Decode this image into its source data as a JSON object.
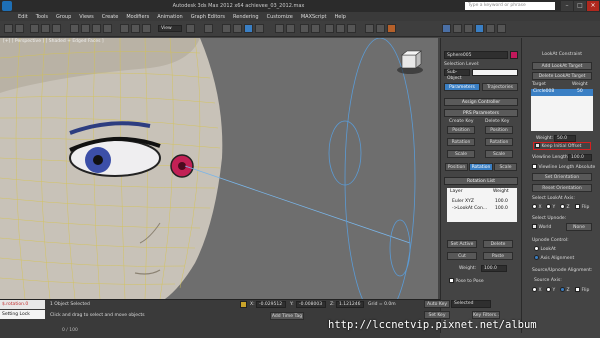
{
  "window": {
    "title": "Autodesk 3ds Max 2012 x64      achievee_03_2012.max",
    "search_placeholder": "Type a keyword or phrase"
  },
  "menu": [
    "Edit",
    "Tools",
    "Group",
    "Views",
    "Create",
    "Modifiers",
    "Animation",
    "Graph Editors",
    "Rendering",
    "Customize",
    "MAXScript",
    "Help"
  ],
  "toolbar": {
    "view_dropdown": "View"
  },
  "viewport": {
    "label": "[+] [ Perspective ] [ Shaded + Edged Faces ]"
  },
  "command_panel": {
    "object_name": "Sphere005",
    "selection_level_label": "Selection Level:",
    "selection_level_value": "Sub-Object",
    "tabs": [
      "Parameters",
      "Trajectories"
    ],
    "assign_controller": "Assign Controller",
    "prs_params": "PRS Parameters",
    "create_key": "Create Key",
    "delete_key": "Delete Key",
    "left_keys": [
      "Position",
      "Rotation",
      "Scale"
    ],
    "right_keys": [
      "Position",
      "Rotation",
      "Scale"
    ],
    "mode_buttons": [
      "Position",
      "Rotation",
      "Scale"
    ],
    "rotation_list": "Rotation List",
    "list_headers": {
      "layer": "Layer",
      "weight": "Weight"
    },
    "list_rows": [
      {
        "layer": "Euler XYZ",
        "weight": "100.0"
      },
      {
        "layer": "->LookAt Con...",
        "weight": "100.0"
      }
    ],
    "set_active": "Set Active",
    "delete": "Delete",
    "cut": "Cut",
    "paste": "Paste",
    "weight_label": "Weight:",
    "weight_value": "100.0",
    "pose_to_pose": "Pose to Pose"
  },
  "lookat_panel": {
    "title": "LookAt Constraint",
    "add_target": "Add LookAt Target",
    "delete_target": "Delete LookAt Target",
    "target_header": "Target",
    "weight_header": "Weight",
    "target_row": {
      "name": "Circle008",
      "weight": "50"
    },
    "weight_label": "Weight:",
    "weight_value": "50.0",
    "keep_initial_offset": "Keep Initial Offset",
    "viewline_length_label": "Viewline Length:",
    "viewline_length_value": "100.0",
    "viewline_absolute": "Viewline Length Absolute",
    "set_orientation": "Set Orientation",
    "reset_orientation": "Reset Orientation",
    "select_lookat_axis": "Select LookAt Axis:",
    "axes": [
      "X",
      "Y",
      "Z"
    ],
    "flip": "Flip",
    "select_upnode": "Select Upnode:",
    "world": "World",
    "none": "None",
    "upnode_control": "Upnode Control:",
    "lookat": "LookAt",
    "axis_alignment": "Axis Alignment",
    "source_upnode": "Source/Upnode Alignment:",
    "source_axis": "Source Axis:",
    "source_axes": [
      "X",
      "Y",
      "Z"
    ],
    "flip2": "Flip"
  },
  "status": {
    "maxscript_top": "$.rotation.0",
    "maxscript_bottom": "Setting Lock",
    "selected": "1 Object Selected",
    "prompt": "Click and drag to select and move objects",
    "x_label": "X:",
    "x_value": "-0.029512",
    "y_label": "Y:",
    "y_value": "-0.008003",
    "z_label": "Z:",
    "z_value": "1.121246",
    "grid": "Grid = 0.0m",
    "auto_key": "Auto Key",
    "selected_dropdown": "Selected",
    "set_key": "Set Key",
    "key_filters": "Key Filters...",
    "add_time_tag": "Add Time Tag",
    "frame": "0 / 100"
  },
  "watermark": "http://lccnetvip.pixnet.net/album"
}
